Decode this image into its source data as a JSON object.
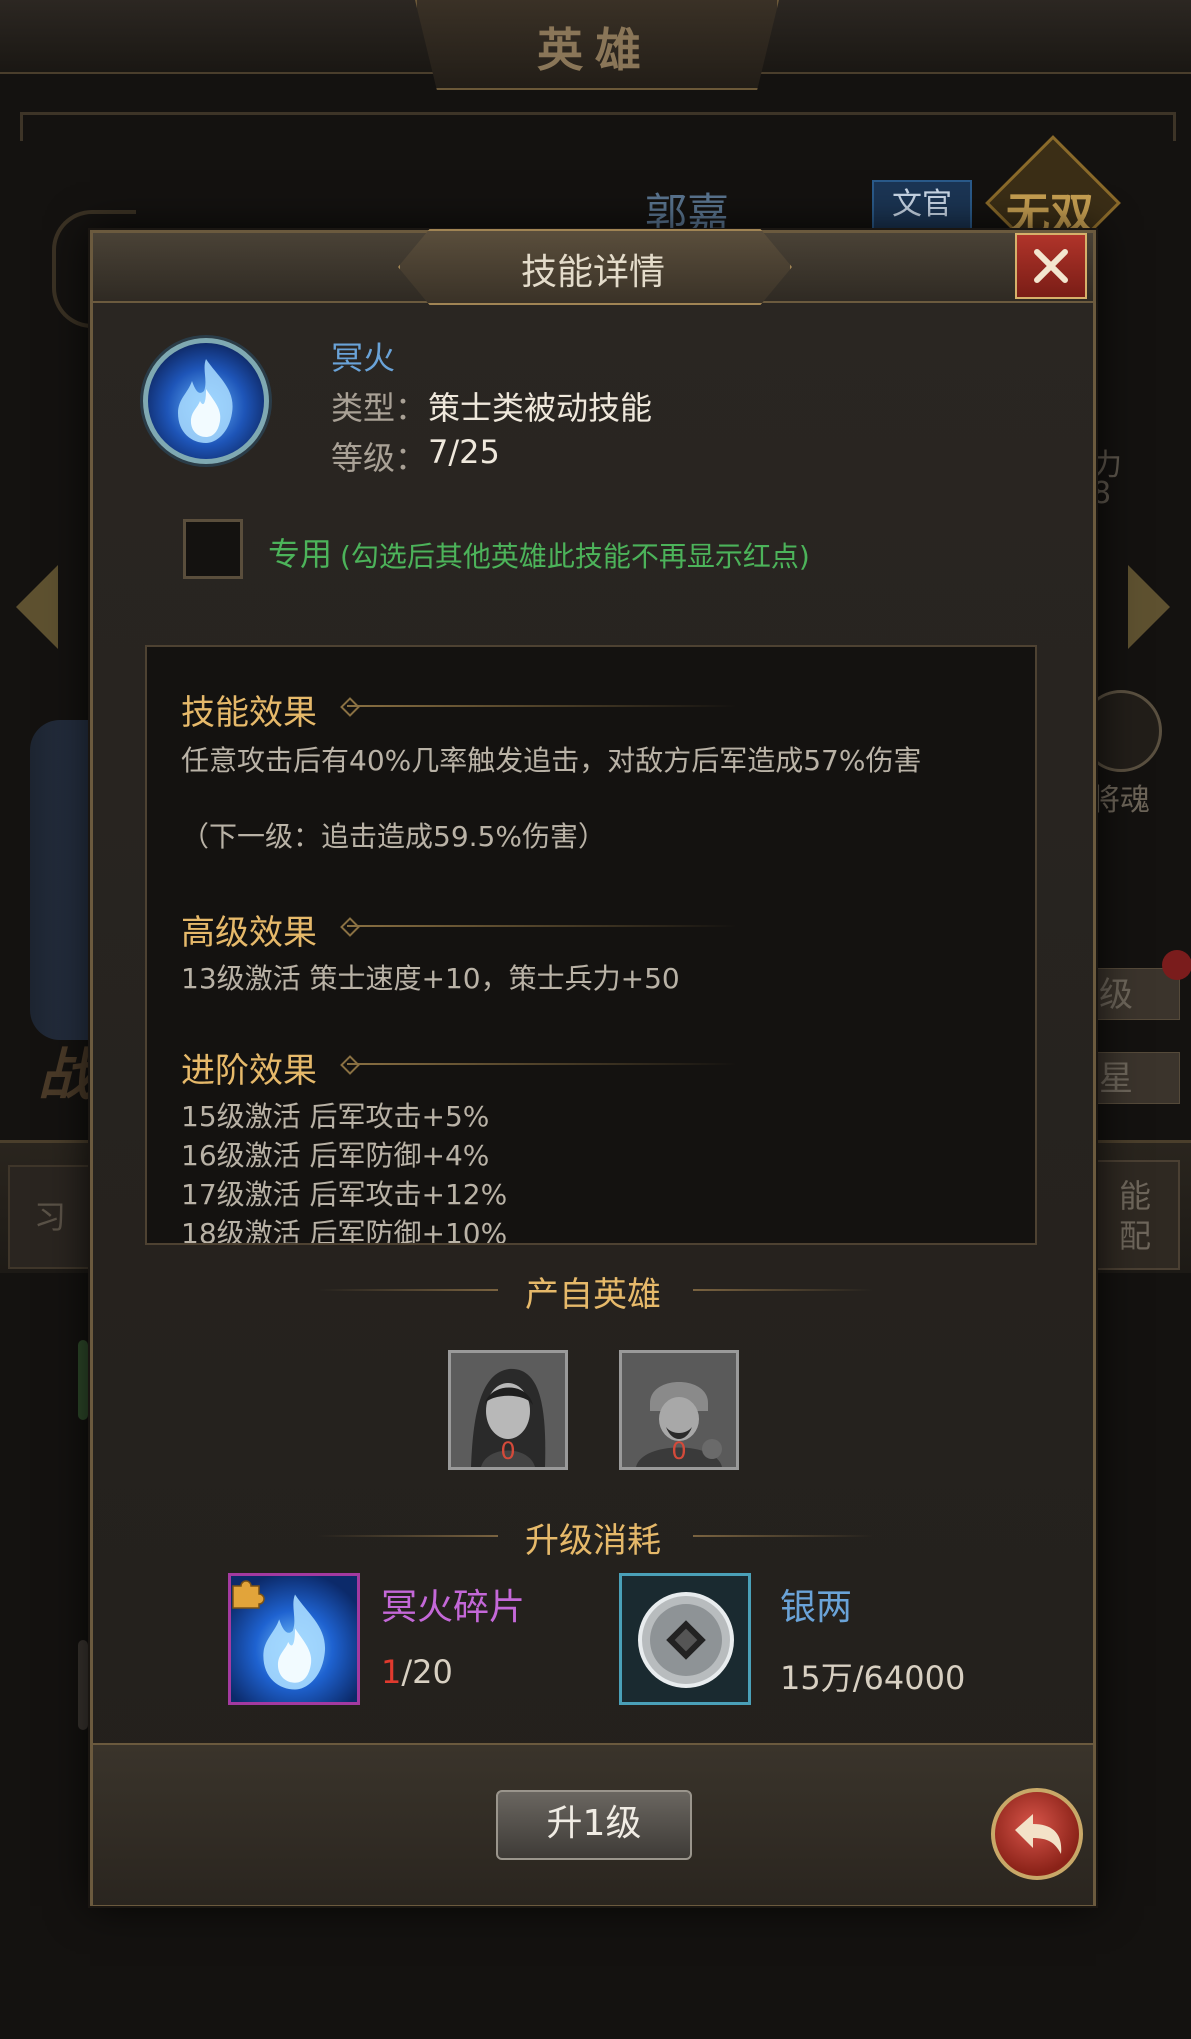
{
  "background": {
    "screen_title": "英雄",
    "hero_name": "郭嘉",
    "hero_class": "文官",
    "emblem": "无双",
    "stat_label": "力",
    "stat_value": "8",
    "soul_label": "将魂",
    "level_button": "级",
    "star_button": "星",
    "left_tab": "习",
    "right_tab_line1": "能",
    "right_tab_line2": "配"
  },
  "dialog": {
    "title": "技能详情",
    "skill": {
      "icon": "blue-flame-icon",
      "name": "冥火",
      "type_label": "类型：",
      "type_value": "策士类被动技能",
      "level_label": "等级：",
      "level_value": "7/25"
    },
    "exclusive": {
      "label": "专用",
      "note": "(勾选后其他英雄此技能不再显示红点)",
      "checked": false
    },
    "effects": {
      "skill_effect": {
        "heading": "技能效果",
        "text": "任意攻击后有40%几率触发追击，对敌方后军造成57%伤害",
        "next_level": "（下一级：追击造成59.5%伤害）"
      },
      "advanced_effect": {
        "heading": "高级效果",
        "text": "13级激活 策士速度+10，策士兵力+50"
      },
      "promotion_effect": {
        "heading": "进阶效果",
        "lines": [
          "15级激活 后军攻击+5%",
          "16级激活 后军防御+4%",
          "17级激活 后军攻击+12%",
          "18级激活 后军防御+10%"
        ]
      }
    },
    "source_heroes": {
      "heading": "产自英雄",
      "heroes": [
        {
          "icon": "hero-portrait-strategist",
          "count": "0"
        },
        {
          "icon": "hero-portrait-armored-general",
          "count": "0"
        }
      ]
    },
    "upgrade_cost": {
      "heading": "升级消耗",
      "items": [
        {
          "name": "冥火碎片",
          "icon": "skill-fragment-icon",
          "have": "1",
          "need": "/20"
        },
        {
          "name": "银两",
          "icon": "silver-coin-icon",
          "amount": "15万/64000"
        }
      ]
    },
    "upgrade_button": "升1级",
    "colors": {
      "accent_gold": "#e6b96a",
      "skill_blue": "#6aa3d8",
      "exclusive_green": "#4cb35a",
      "fragment_purple": "#c468d8",
      "insufficient_red": "#e03a2e"
    }
  }
}
